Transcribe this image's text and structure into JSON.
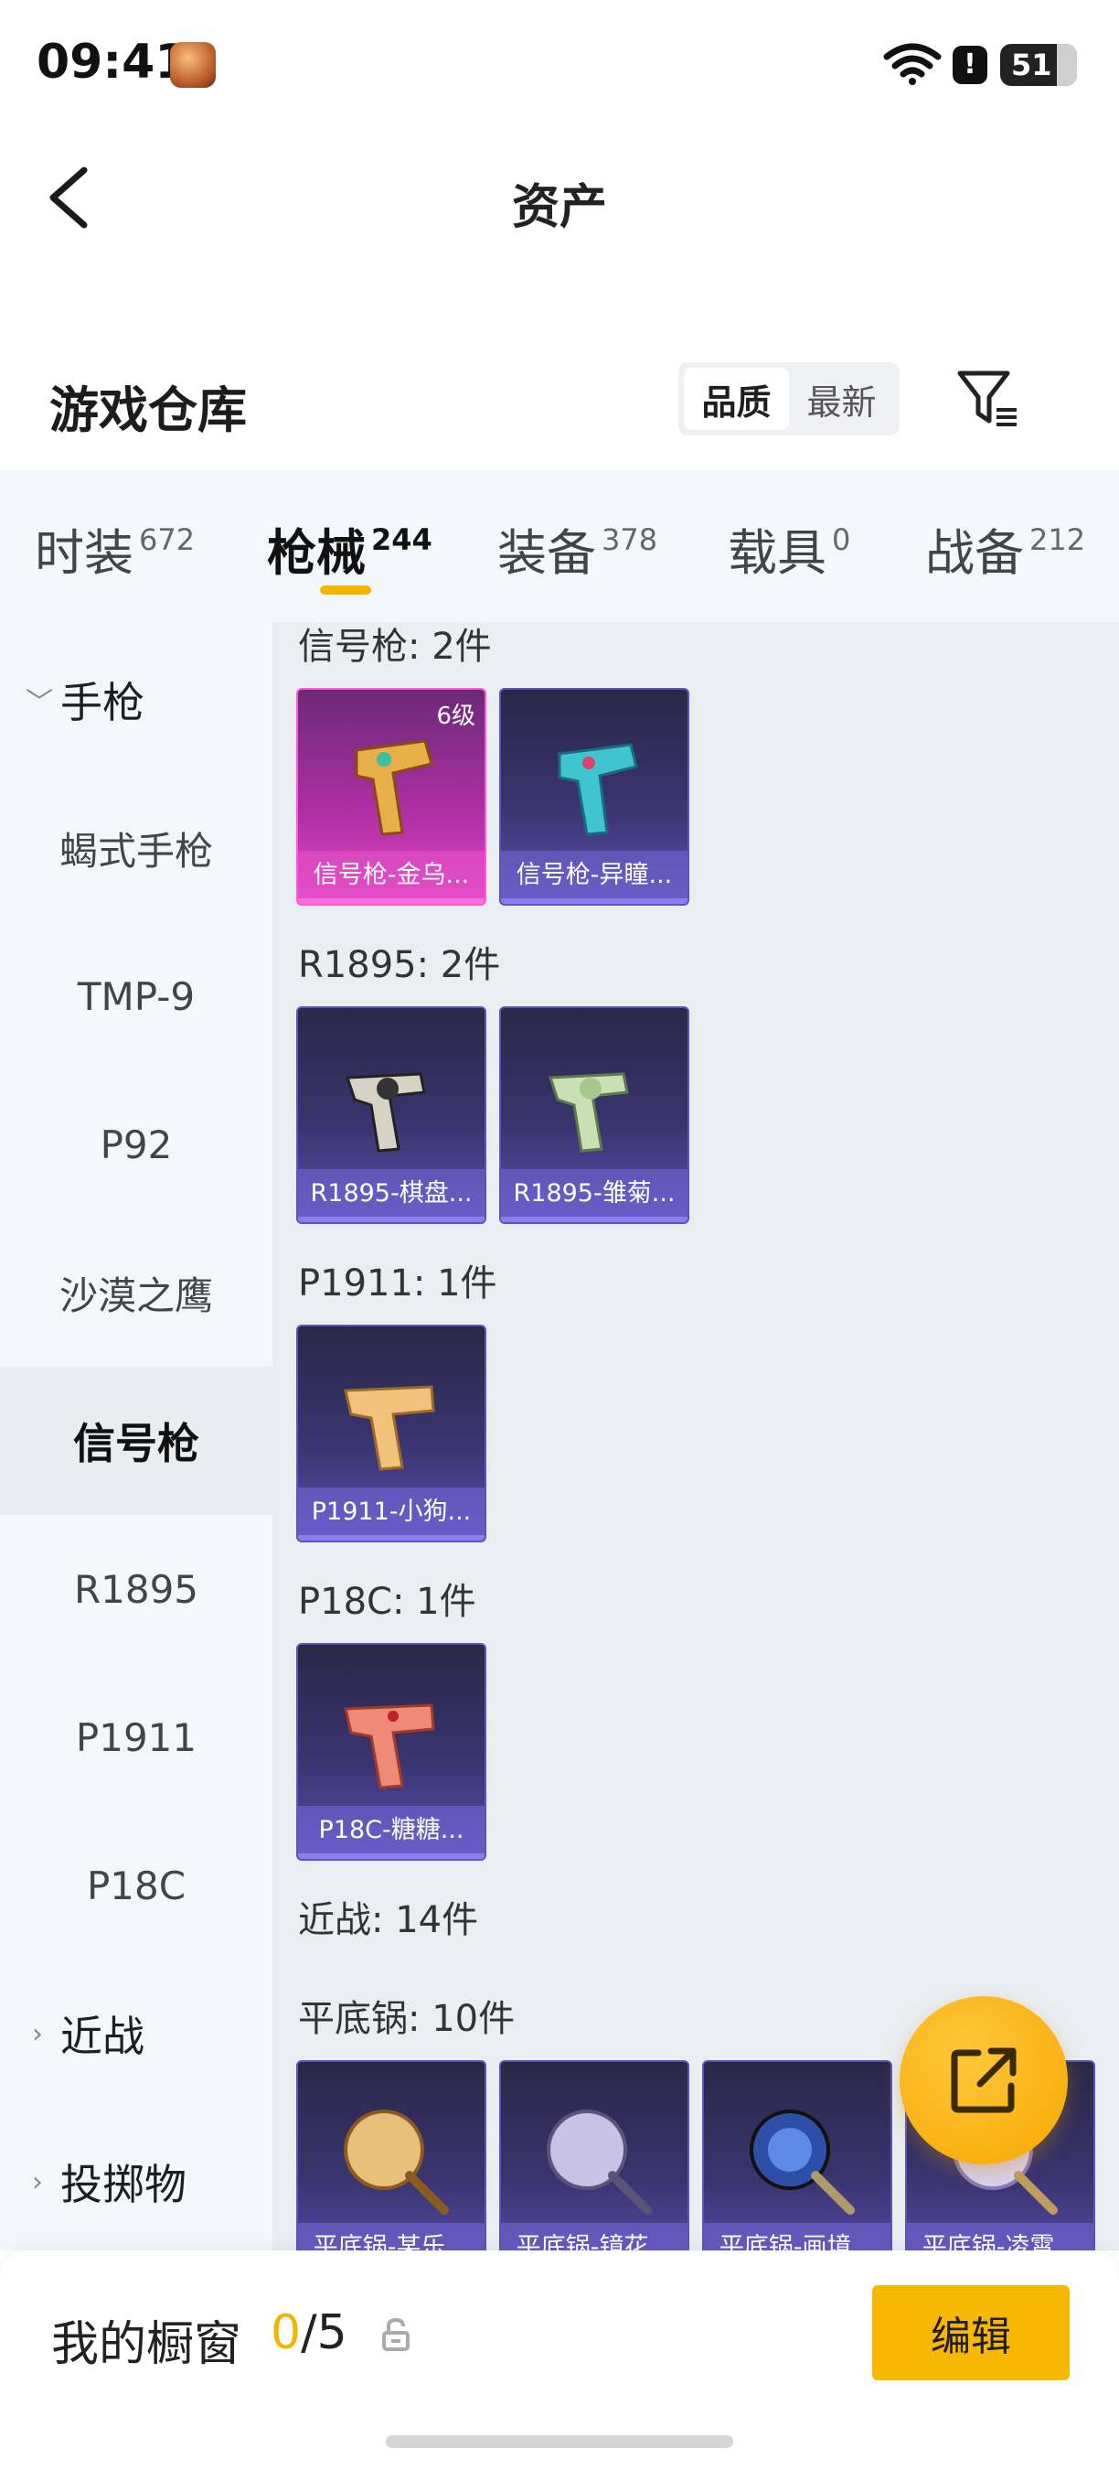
{
  "status_bar": {
    "time": "09:41",
    "battery": "51"
  },
  "header": {
    "title": "资产",
    "back_icon": "chevron-left-icon"
  },
  "warehouse": {
    "title": "游戏仓库",
    "sort_options": [
      "品质",
      "最新"
    ],
    "selected_sort": "品质",
    "filter_icon": "filter-icon"
  },
  "tabs": [
    {
      "label": "时装",
      "count": "672"
    },
    {
      "label": "枪械",
      "count": "244",
      "active": true
    },
    {
      "label": "装备",
      "count": "378"
    },
    {
      "label": "载具",
      "count": "0"
    },
    {
      "label": "战备",
      "count": "212"
    }
  ],
  "sidebar": {
    "group_pistol": "手枪",
    "items": [
      "蝎式手枪",
      "TMP-9",
      "P92",
      "沙漠之鹰",
      "信号枪",
      "R1895",
      "P1911",
      "P18C"
    ],
    "active_item": "信号枪",
    "group_melee": "近战",
    "group_throw": "投掷物"
  },
  "sections": [
    {
      "label": "信号枪: 2件",
      "cards": [
        {
          "name": "信号枪-金乌...",
          "badge": "6级",
          "rarity": "gold"
        },
        {
          "name": "信号枪-异瞳..."
        }
      ]
    },
    {
      "label": "R1895: 2件",
      "cards": [
        {
          "name": "R1895-棋盘..."
        },
        {
          "name": "R1895-雏菊..."
        }
      ]
    },
    {
      "label": "P1911: 1件",
      "cards": [
        {
          "name": "P1911-小狗..."
        }
      ]
    },
    {
      "label": "P18C: 1件",
      "cards": [
        {
          "name": "P18C-糖糖..."
        }
      ]
    },
    {
      "label": "近战: 14件"
    },
    {
      "label": "平底锅: 10件",
      "cards": [
        {
          "name": "平底锅-某乐..."
        },
        {
          "name": "平底锅-镜花..."
        },
        {
          "name": "平底锅-画境..."
        },
        {
          "name": "平底锅-凌霄..."
        }
      ]
    }
  ],
  "fab": {
    "icon": "share-icon"
  },
  "bottom": {
    "showcase_label": "我的橱窗",
    "showcase_current": "0",
    "showcase_sep_total": "/5",
    "edit_label": "编辑"
  },
  "colors": {
    "accent": "#f5b400",
    "card_purple": "#3a3470",
    "card_gold": "#b22fa6"
  }
}
